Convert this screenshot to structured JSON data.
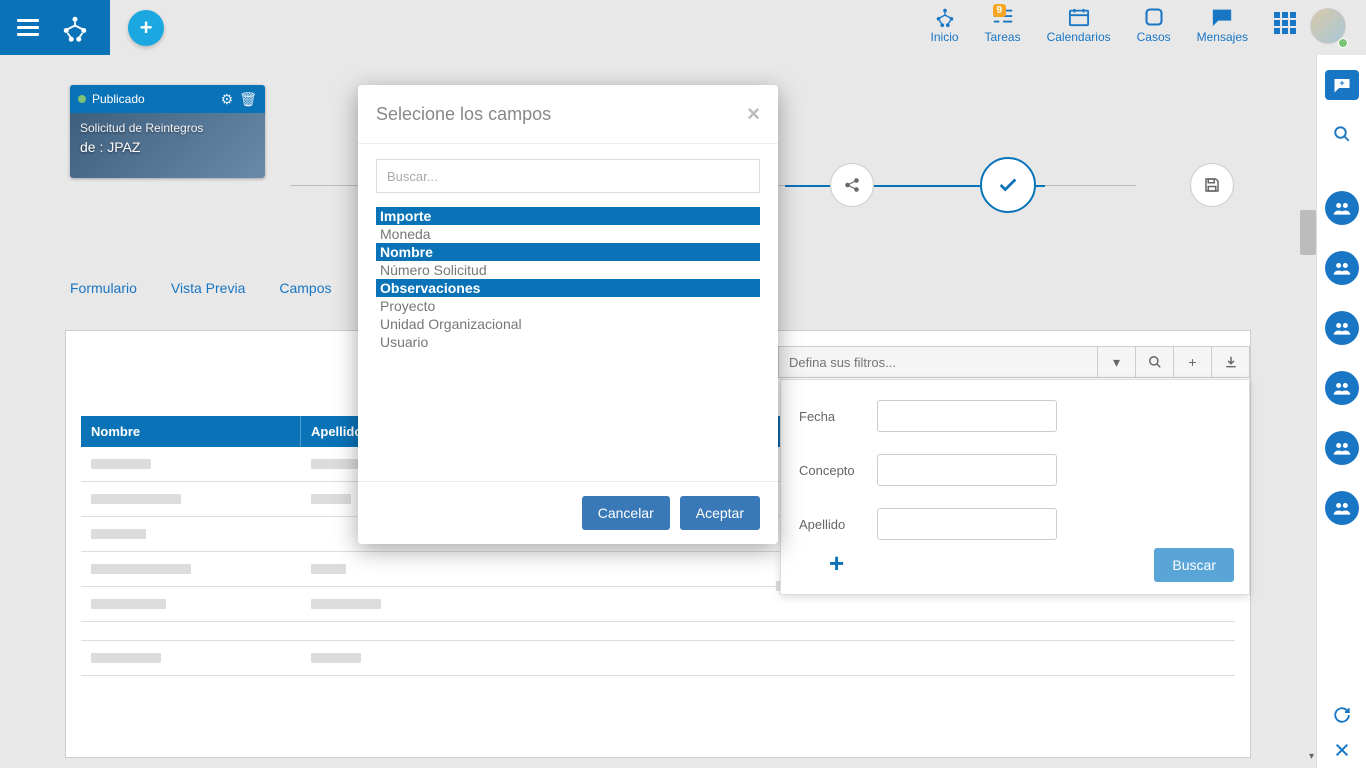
{
  "topnav": {
    "inicio": "Inicio",
    "tareas": "Tareas",
    "tareas_badge": "9",
    "calendarios": "Calendarios",
    "casos": "Casos",
    "mensajes": "Mensajes"
  },
  "card": {
    "status": "Publicado",
    "title": "Solicitud de Reintegros",
    "author_prefix": "de : ",
    "author": "JPAZ"
  },
  "tabs": {
    "formulario": "Formulario",
    "vista_previa": "Vista Previa",
    "campos": "Campos"
  },
  "filter_bar": {
    "placeholder": "Defina sus filtros..."
  },
  "table": {
    "headers": [
      "Nombre",
      "Apellido"
    ]
  },
  "filter_panel": {
    "labels": {
      "fecha": "Fecha",
      "concepto": "Concepto",
      "apellido": "Apellido"
    },
    "buscar": "Buscar"
  },
  "modal": {
    "title": "Selecione los campos",
    "search_placeholder": "Buscar...",
    "fields": [
      {
        "label": "Importe",
        "selected": true
      },
      {
        "label": "Moneda",
        "selected": false
      },
      {
        "label": "Nombre",
        "selected": true
      },
      {
        "label": "Número Solicitud",
        "selected": false
      },
      {
        "label": "Observaciones",
        "selected": true
      },
      {
        "label": "Proyecto",
        "selected": false
      },
      {
        "label": "Unidad Organizacional",
        "selected": false
      },
      {
        "label": "Usuario",
        "selected": false
      }
    ],
    "cancel": "Cancelar",
    "accept": "Aceptar"
  }
}
